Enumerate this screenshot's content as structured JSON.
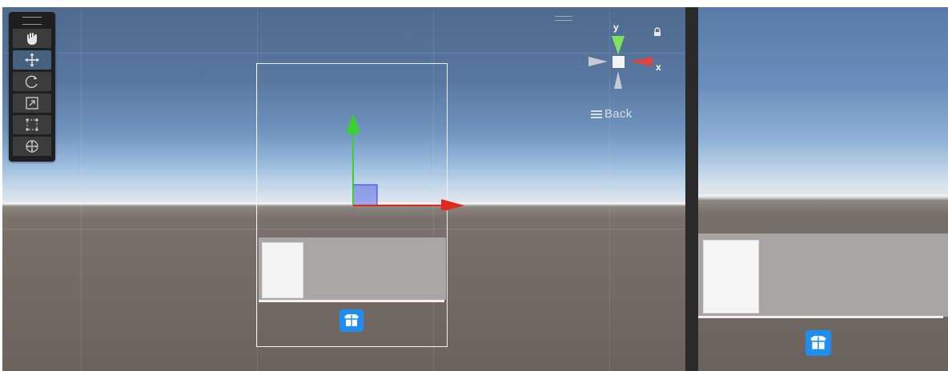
{
  "scene_view": {
    "tools": [
      {
        "name": "hand-tool",
        "icon": "hand-icon",
        "active": false
      },
      {
        "name": "move-tool",
        "icon": "move-icon",
        "active": true
      },
      {
        "name": "rotate-tool",
        "icon": "rotate-icon",
        "active": false
      },
      {
        "name": "scale-tool",
        "icon": "scale-icon",
        "active": false
      },
      {
        "name": "rect-tool",
        "icon": "rect-icon",
        "active": false
      },
      {
        "name": "transform-tool",
        "icon": "transform-icon",
        "active": false
      }
    ],
    "orientation_gizmo": {
      "y_label": "y",
      "x_label": "x"
    },
    "back_label": "Back"
  },
  "colors": {
    "x_axis": "#e02a1f",
    "y_axis": "#3ad12f",
    "selection_blue": "#1e8ef0"
  }
}
